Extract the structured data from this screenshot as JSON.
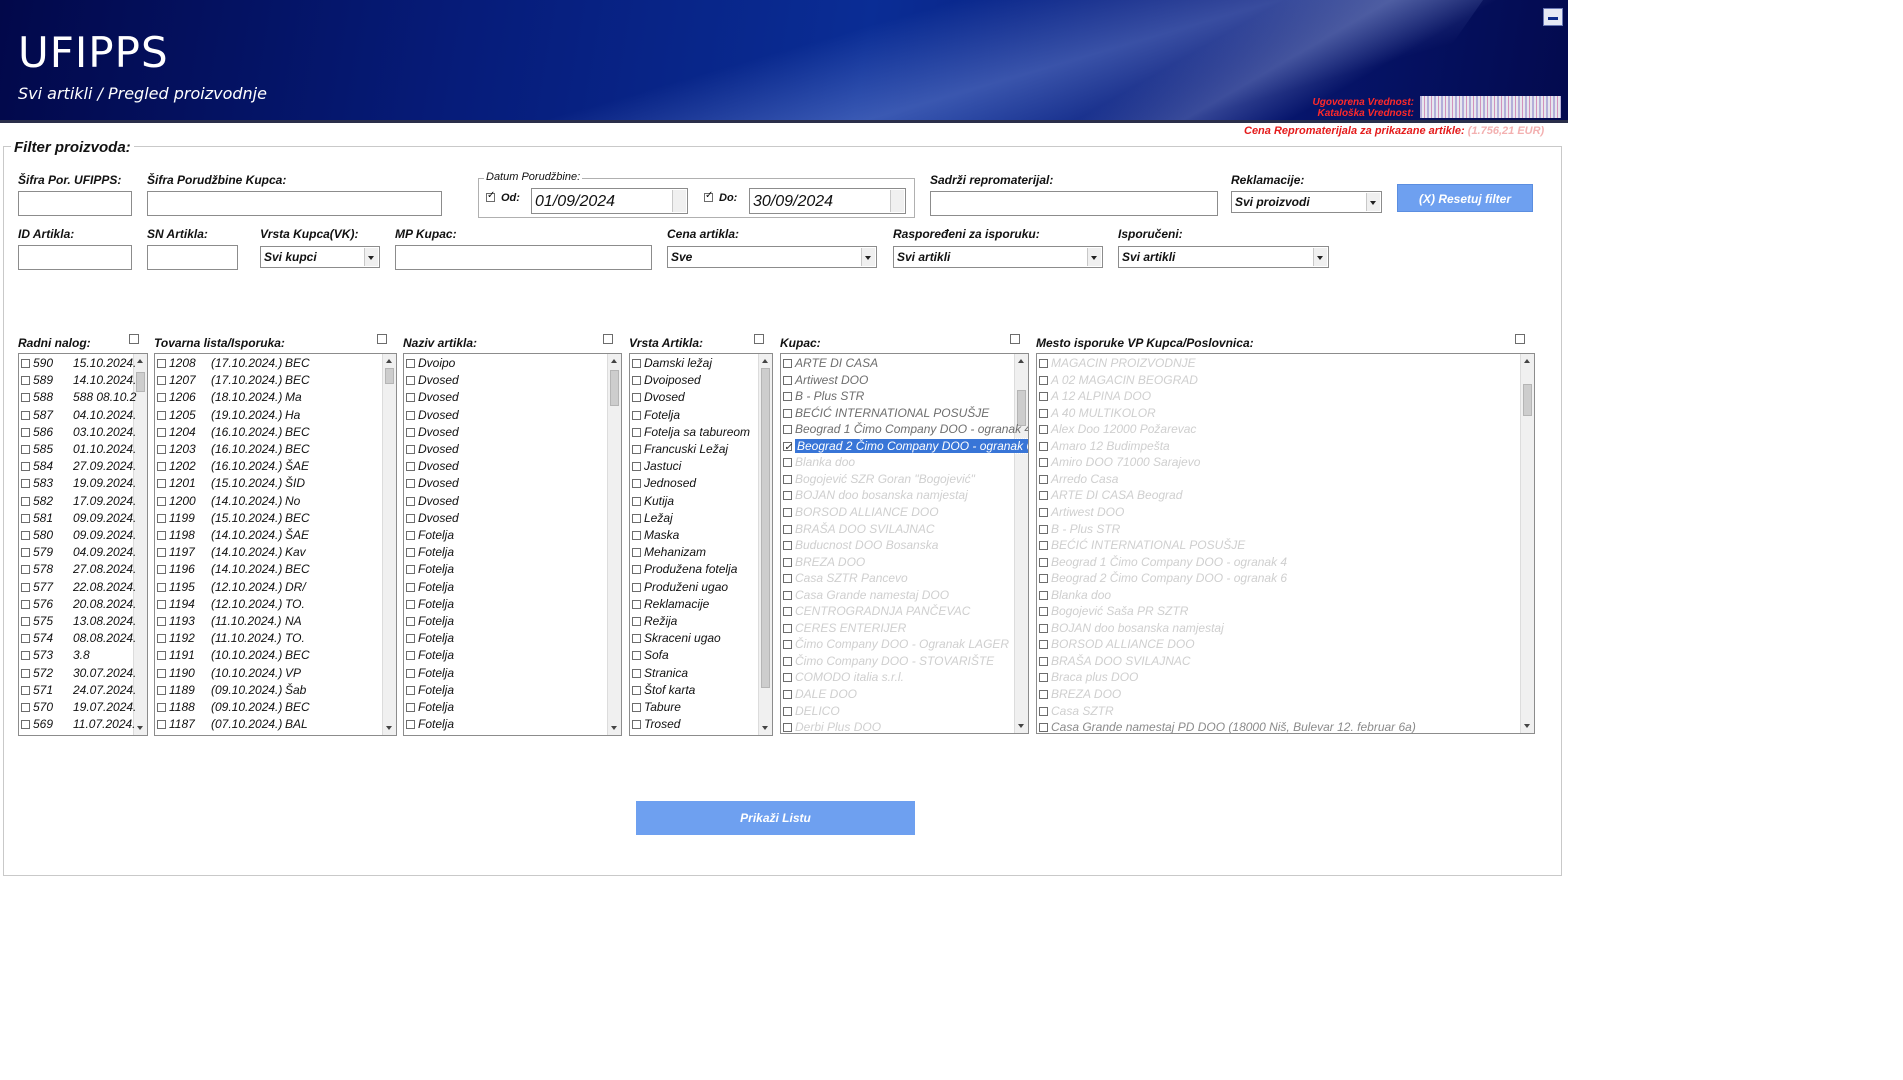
{
  "header": {
    "title": "UFIPPS",
    "subtitle": "Svi artikli / Pregled proizvodnje",
    "ugovorena_label": "Ugovorena Vrednost:",
    "kataloska_label": "Kataloška Vrednost:",
    "cena_repromaterijala_label": "Cena Repromaterijala za prikazane artikle:",
    "cena_repromaterijala_value": "(1.756,21 EUR)"
  },
  "filter": {
    "legend": "Filter proizvoda:",
    "sifra_por_ufipps": {
      "label": "Šifra Por. UFIPPS:",
      "value": ""
    },
    "sifra_porudzbine_kupca": {
      "label": "Šifra Porudžbine Kupca:",
      "value": ""
    },
    "datum": {
      "group_label": "Datum Porudžbine:",
      "od_label": "Od:",
      "od_checked": true,
      "od_value": "01/09/2024",
      "do_label": "Do:",
      "do_checked": true,
      "do_value": "30/09/2024"
    },
    "sadrzi_repromaterijal": {
      "label": "Sadrži repromaterijal:",
      "value": ""
    },
    "reklamacije": {
      "label": "Reklamacije:",
      "value": "Svi proizvodi"
    },
    "reset_button": "(X) Resetuj filter",
    "id_artikla": {
      "label": "ID Artikla:",
      "value": ""
    },
    "sn_artikla": {
      "label": "SN Artikla:",
      "value": ""
    },
    "vrsta_kupca": {
      "label": "Vrsta Kupca(VK):",
      "value": "Svi kupci"
    },
    "mp_kupac": {
      "label": "MP Kupac:",
      "value": ""
    },
    "cena_artikla": {
      "label": "Cena artikla:",
      "value": "Sve"
    },
    "rasporedeni": {
      "label": "Raspoređeni za isporuku:",
      "value": "Svi  artikli"
    },
    "isporuceni": {
      "label": "Isporučeni:",
      "value": "Svi  artikli"
    }
  },
  "lists": {
    "radni_nalog": {
      "label": "Radni nalog:",
      "items": [
        {
          "num": "590",
          "date": "15.10.2024."
        },
        {
          "num": "589",
          "date": "14.10.2024."
        },
        {
          "num": "588",
          "date": "588 08.10.2"
        },
        {
          "num": "587",
          "date": "04.10.2024."
        },
        {
          "num": "586",
          "date": "03.10.2024."
        },
        {
          "num": "585",
          "date": "01.10.2024."
        },
        {
          "num": "584",
          "date": "27.09.2024."
        },
        {
          "num": "583",
          "date": "19.09.2024."
        },
        {
          "num": "582",
          "date": "17.09.2024."
        },
        {
          "num": "581",
          "date": "09.09.2024."
        },
        {
          "num": "580",
          "date": "09.09.2024."
        },
        {
          "num": "579",
          "date": "04.09.2024."
        },
        {
          "num": "578",
          "date": "27.08.2024."
        },
        {
          "num": "577",
          "date": "22.08.2024."
        },
        {
          "num": "576",
          "date": "20.08.2024."
        },
        {
          "num": "575",
          "date": "13.08.2024."
        },
        {
          "num": "574",
          "date": "08.08.2024."
        },
        {
          "num": "573",
          "date": "3.8"
        },
        {
          "num": "572",
          "date": "30.07.2024."
        },
        {
          "num": "571",
          "date": "24.07.2024."
        },
        {
          "num": "570",
          "date": "19.07.2024."
        },
        {
          "num": "569",
          "date": "11.07.2024."
        }
      ]
    },
    "tovarna_lista": {
      "label": "Tovarna lista/Isporuka:",
      "items": [
        {
          "num": "1208",
          "date": "(17.10.2024.)",
          "text": "BEC"
        },
        {
          "num": "1207",
          "date": "(17.10.2024.)",
          "text": "BEC"
        },
        {
          "num": "1206",
          "date": "(18.10.2024.)",
          "text": "Ma"
        },
        {
          "num": "1205",
          "date": "(19.10.2024.)",
          "text": "Ha"
        },
        {
          "num": "1204",
          "date": "(16.10.2024.)",
          "text": "BEC"
        },
        {
          "num": "1203",
          "date": "(16.10.2024.)",
          "text": "BEC"
        },
        {
          "num": "1202",
          "date": "(16.10.2024.)",
          "text": "ŠAE"
        },
        {
          "num": "1201",
          "date": "(15.10.2024.)",
          "text": "ŠID"
        },
        {
          "num": "1200",
          "date": "(14.10.2024.)",
          "text": "No"
        },
        {
          "num": "1199",
          "date": "(15.10.2024.)",
          "text": "BEC"
        },
        {
          "num": "1198",
          "date": "(14.10.2024.)",
          "text": "ŠAE"
        },
        {
          "num": "1197",
          "date": "(14.10.2024.)",
          "text": "Kav"
        },
        {
          "num": "1196",
          "date": "(14.10.2024.)",
          "text": "BEC"
        },
        {
          "num": "1195",
          "date": "(12.10.2024.)",
          "text": "DR/"
        },
        {
          "num": "1194",
          "date": "(12.10.2024.)",
          "text": "TO."
        },
        {
          "num": "1193",
          "date": "(11.10.2024.)",
          "text": "NA"
        },
        {
          "num": "1192",
          "date": "(11.10.2024.)",
          "text": "TO."
        },
        {
          "num": "1191",
          "date": "(10.10.2024.)",
          "text": "BEC"
        },
        {
          "num": "1190",
          "date": "(10.10.2024.)",
          "text": "VP"
        },
        {
          "num": "1189",
          "date": "(09.10.2024.)",
          "text": "Šab"
        },
        {
          "num": "1188",
          "date": "(09.10.2024.)",
          "text": "BEC"
        },
        {
          "num": "1187",
          "date": "(07.10.2024.)",
          "text": "BAL"
        }
      ]
    },
    "naziv_artikla": {
      "label": "Naziv artikla:",
      "items": [
        "Dvoipo",
        "Dvosed",
        "Dvosed",
        "Dvosed",
        "Dvosed",
        "Dvosed",
        "Dvosed",
        "Dvosed",
        "Dvosed",
        "Dvosed",
        "Fotelja",
        "Fotelja",
        "Fotelja",
        "Fotelja",
        "Fotelja",
        "Fotelja",
        "Fotelja",
        "Fotelja",
        "Fotelja",
        "Fotelja",
        "Fotelja",
        "Fotelja"
      ]
    },
    "vrsta_artikla": {
      "label": "Vrsta Artikla:",
      "items": [
        "Damski ležaj",
        "Dvoiposed",
        "Dvosed",
        "Fotelja",
        "Fotelja sa taburеom",
        "Francuski Ležaj",
        "Jastuci",
        "Jednosed",
        "Kutija",
        "Ležaj",
        "Maska",
        "Mehanizam",
        "Produžena fotelja",
        "Produženi ugao",
        "Reklamacije",
        "Režija",
        "Skraceni ugao",
        "Sofa",
        "Stranica",
        "Štof karta",
        "Tabure",
        "Trosed"
      ]
    },
    "kupac": {
      "label": "Kupac:",
      "items": [
        {
          "text": "ARTE DI CASA",
          "checked": false,
          "selected": false
        },
        {
          "text": "Artiwest DOO",
          "checked": false,
          "selected": false
        },
        {
          "text": "B - Plus STR",
          "checked": false,
          "selected": false
        },
        {
          "text": "BEĆIĆ INTERNATIONAL POSUŠJE",
          "checked": false,
          "selected": false
        },
        {
          "text": "Beograd 1 Čimo Company DOO - ogranak 4",
          "checked": false,
          "selected": false
        },
        {
          "text": "Beograd 2 Čimo Company DOO - ogranak 6",
          "checked": true,
          "selected": true
        },
        {
          "text": "Blanka doo",
          "checked": false,
          "selected": false
        },
        {
          "text": "Bogojević SZR Goran \"Bogojević\"",
          "checked": false,
          "selected": false
        },
        {
          "text": "BOJAN doo bosanska namjestaj",
          "checked": false,
          "selected": false
        },
        {
          "text": "BORSOD ALLIANCE DOO",
          "checked": false,
          "selected": false
        },
        {
          "text": "BRAŠA DOO SVILAJNAC",
          "checked": false,
          "selected": false
        },
        {
          "text": "Buducnost DOO Bosanska",
          "checked": false,
          "selected": false
        },
        {
          "text": "BREZA DOO",
          "checked": false,
          "selected": false
        },
        {
          "text": "Casa SZTR Pancevo",
          "checked": false,
          "selected": false
        },
        {
          "text": "Casa Grande namestaj DOO",
          "checked": false,
          "selected": false
        },
        {
          "text": "CENTROGRADNJA PANČEVAC",
          "checked": false,
          "selected": false
        },
        {
          "text": "CERES ENTERIJER",
          "checked": false,
          "selected": false
        },
        {
          "text": "Čimo Company DOO - Ogranak LAGER",
          "checked": false,
          "selected": false
        },
        {
          "text": "Čimo Company DOO - STOVARIŠTE",
          "checked": false,
          "selected": false
        },
        {
          "text": "COMODO italia s.r.l.",
          "checked": false,
          "selected": false
        },
        {
          "text": "DALE DOO",
          "checked": false,
          "selected": false
        },
        {
          "text": "DELICO",
          "checked": false,
          "selected": false
        },
        {
          "text": "Derbi Plus DOO",
          "checked": false,
          "selected": false
        }
      ]
    },
    "mesto_isporuke": {
      "label": "Mesto isporuke VP Kupca/Poslovnica:",
      "items": [
        "MAGACIN PROIZVODNJE",
        "A 02 MAGACIN BEOGRAD",
        "A 12 ALPINA DOO",
        "A 40 MULTIKOLOR",
        "Alex Doo 12000 Požarevac",
        "Amaro 12 Budimpešta",
        "Amiro DOO 71000 Sarajevo",
        "Arredo Casa",
        "ARTE DI CASA Beograd",
        "Artiwest DOO",
        "B - Plus STR",
        "BEĆIĆ INTERNATIONAL POSUŠJE",
        "Beograd 1 Čimo Company DOO - ogranak 4",
        "Beograd 2 Čimo Company DOO - ogranak 6",
        "Blanka doo",
        "Bogojević Saša PR SZTR",
        "BOJAN doo bosanska namjestaj",
        "BORSOD ALLIANCE DOO",
        "BRAŠA DOO SVILAJNAC",
        "Braca plus DOO",
        "BREZA DOO",
        "Casa SZTR",
        "Casa Grande namestaj PD DOO (18000 Niš, Bulevar 12. februar 6a)"
      ]
    }
  },
  "buttons": {
    "prikazi_listu": "Prikaži Listu"
  },
  "colors": {
    "banner_dark": "#02084a",
    "banner_mid": "#0a2d95",
    "button_blue": "#6ea0f0",
    "selection_blue": "#3875d7",
    "warning_red": "#e41b1b"
  }
}
